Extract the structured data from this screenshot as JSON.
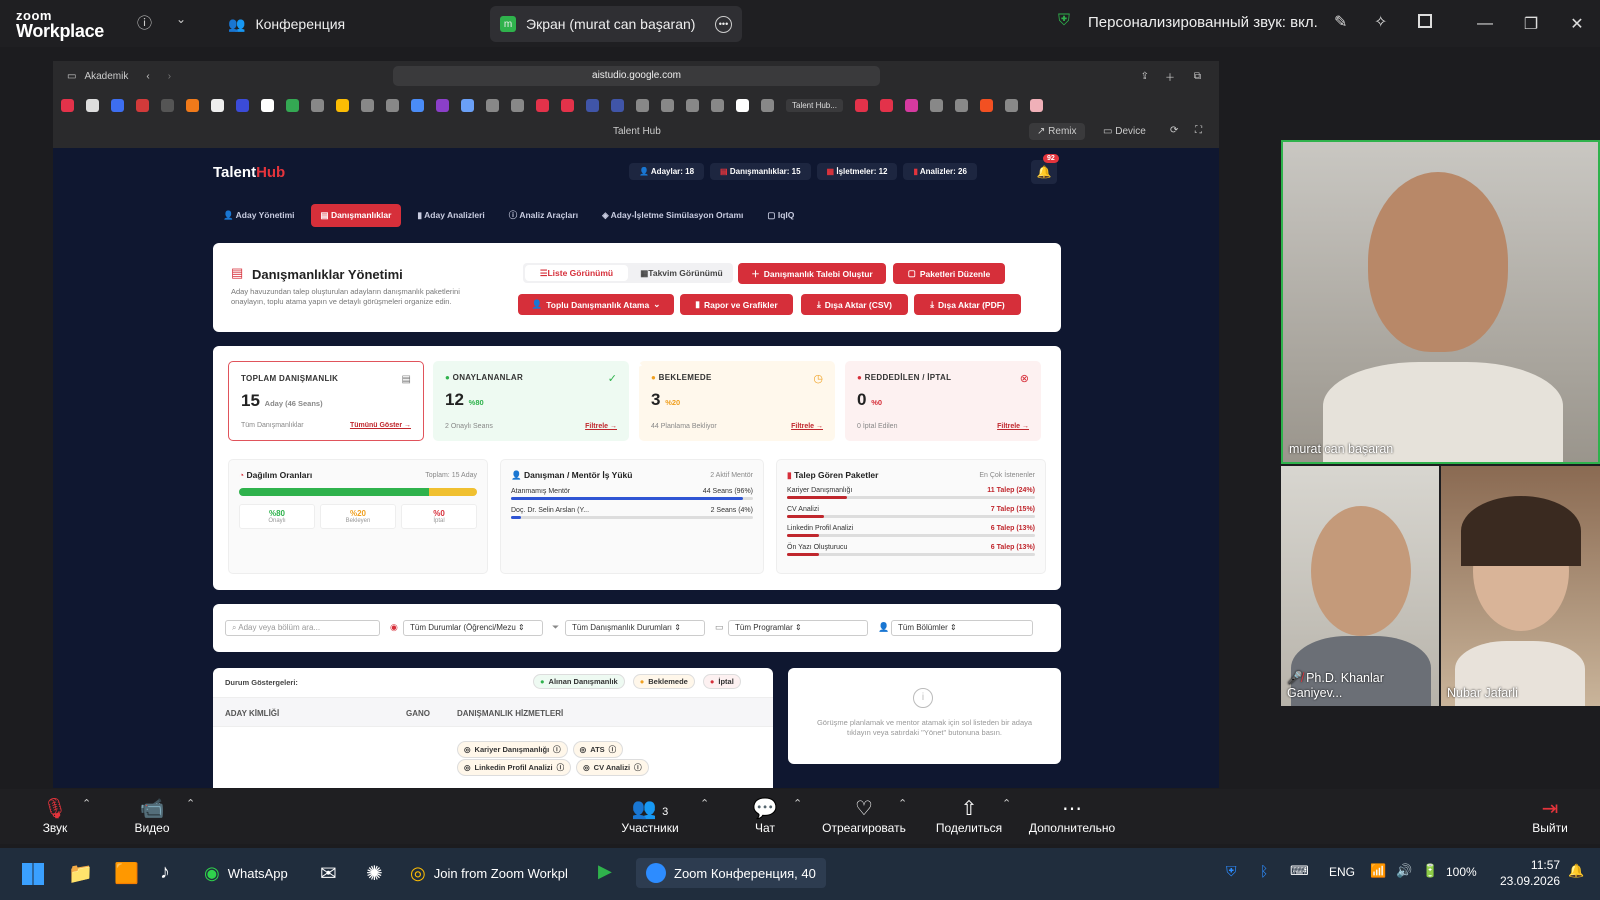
{
  "zoom": {
    "logo_top": "zoom",
    "logo_bottom": "Workplace",
    "tab_conference": "Конференция",
    "tab_screen": "Экран (murat can başaran)",
    "sound_status": "Персонализированный звук: вкл."
  },
  "browser": {
    "profile": "Akademik",
    "url": "aistudio.google.com",
    "tab_label": "Talent Hub...",
    "page_title": "Talent Hub",
    "remix": "Remix",
    "device": "Device"
  },
  "app": {
    "brand_a": "Talent",
    "brand_b": "Hub",
    "counters": [
      "Adaylar: 18",
      "Danışmanlıklar: 15",
      "İşletmeler: 12",
      "Analizler: 26"
    ],
    "notif_count": "92",
    "nav": [
      "Aday Yönetimi",
      "Danışmanlıklar",
      "Aday Analizleri",
      "Analiz Araçları",
      "Aday-İşletme Simülasyon Ortamı",
      "IqIQ"
    ],
    "mgmt": {
      "title": "Danışmanlıklar Yönetimi",
      "desc1": "Aday havuzundan talep oluşturulan adayların danışmanlık paketlerini",
      "desc2": "onaylayın, toplu atama yapın ve detaylı görüşmeleri organize edin.",
      "list_view": "Liste Görünümü",
      "calendar_view": "Takvim Görünümü",
      "create": "Danışmanlık Talebi Oluştur",
      "packages": "Paketleri Düzenle",
      "bulk": "Toplu Danışmanlık Atama",
      "report": "Rapor ve Grafikler",
      "csv": "Dışa Aktar (CSV)",
      "pdf": "Dışa Aktar (PDF)"
    },
    "stats": [
      {
        "title": "TOPLAM DANIŞMANLIK",
        "num": "15",
        "sub": "Aday (46 Seans)",
        "foot": "Tüm Danışmanlıklar",
        "link": "Tümünü Göster →"
      },
      {
        "title": "ONAYLANANLAR",
        "num": "12",
        "sub": "%80",
        "foot": "2 Onaylı Seans",
        "link": "Filtrele →"
      },
      {
        "title": "BEKLEMEDE",
        "num": "3",
        "sub": "%20",
        "foot": "44 Planlama Bekliyor",
        "link": "Filtrele →"
      },
      {
        "title": "REDDEDİLEN / İPTAL",
        "num": "0",
        "sub": "%0",
        "foot": "0 İptal Edilen",
        "link": "Filtrele →"
      }
    ],
    "dist": {
      "title": "Dağılım Oranları",
      "total": "Toplam: 15 Aday",
      "approved_pct": 80,
      "pending_pct": 20,
      "cells": [
        {
          "v": "%80",
          "l": "Onaylı"
        },
        {
          "v": "%20",
          "l": "Bekleyen"
        },
        {
          "v": "%0",
          "l": "İptal"
        }
      ]
    },
    "mentor": {
      "title": "Danışman / Mentör İş Yükü",
      "badge": "2 Aktif Mentör",
      "rows": [
        {
          "n": "Atanmamış Mentör",
          "v": "44 Seans (96%)",
          "pct": 96
        },
        {
          "n": "Doç. Dr. Selin Arslan (Y...",
          "v": "2 Seans (4%)",
          "pct": 4
        }
      ]
    },
    "packages": {
      "title": "Talep Gören Paketler",
      "badge": "En Çok İstenenler",
      "rows": [
        {
          "n": "Kariyer Danışmanlığı",
          "v": "11 Talep (24%)",
          "pct": 24
        },
        {
          "n": "CV Analizi",
          "v": "7 Talep (15%)",
          "pct": 15
        },
        {
          "n": "Linkedin Profil Analizi",
          "v": "6 Talep (13%)",
          "pct": 13
        },
        {
          "n": "Ön Yazı Oluşturucu",
          "v": "6 Talep (13%)",
          "pct": 13
        }
      ]
    },
    "filters": {
      "search_ph": "Aday veya bölüm ara...",
      "f1": "Tüm Durumlar (Öğrenci/Mezu",
      "f2": "Tüm Danışmanlık Durumları",
      "f3": "Tüm Programlar",
      "f4": "Tüm Bölümler"
    },
    "table": {
      "legend_title": "Durum Göstergeleri:",
      "legend": [
        "Alınan Danışmanlık",
        "Beklemede",
        "İptal"
      ],
      "cols": [
        "ADAY KİMLİĞİ",
        "GANO",
        "DANIŞMANLIK HİZMETLERİ"
      ],
      "tags": [
        "Kariyer Danışmanlığı",
        "ATS",
        "Linkedin Profil Analizi",
        "CV Analizi"
      ]
    },
    "side_hint": "Görüşme planlamak ve mentor atamak için sol listeden bir adaya tıklayın veya satırdaki \"Yönet\" butonuna basın."
  },
  "participants": [
    {
      "name": "murat can başaran"
    },
    {
      "name": "Ph.D. Khanlar Ganiyev..."
    },
    {
      "name": "Nubar Jafarli"
    }
  ],
  "controls": {
    "audio": "Звук",
    "video": "Видео",
    "participants": "Участники",
    "participants_count": "3",
    "chat": "Чат",
    "react": "Отреагировать",
    "share": "Поделиться",
    "more": "Дополнительно",
    "leave": "Выйти"
  },
  "taskbar": {
    "whatsapp": "WhatsApp",
    "chrome_join": "Join from Zoom Workpl",
    "zoom_conf": "Zoom Конференция, 40",
    "lang": "ENG",
    "battery": "100%",
    "time": "11:57",
    "date": "23.09.2026"
  },
  "colors": {
    "accent": "#d62f3a",
    "zoom_green": "#2fb24c",
    "app_bg": "#0f1730"
  }
}
